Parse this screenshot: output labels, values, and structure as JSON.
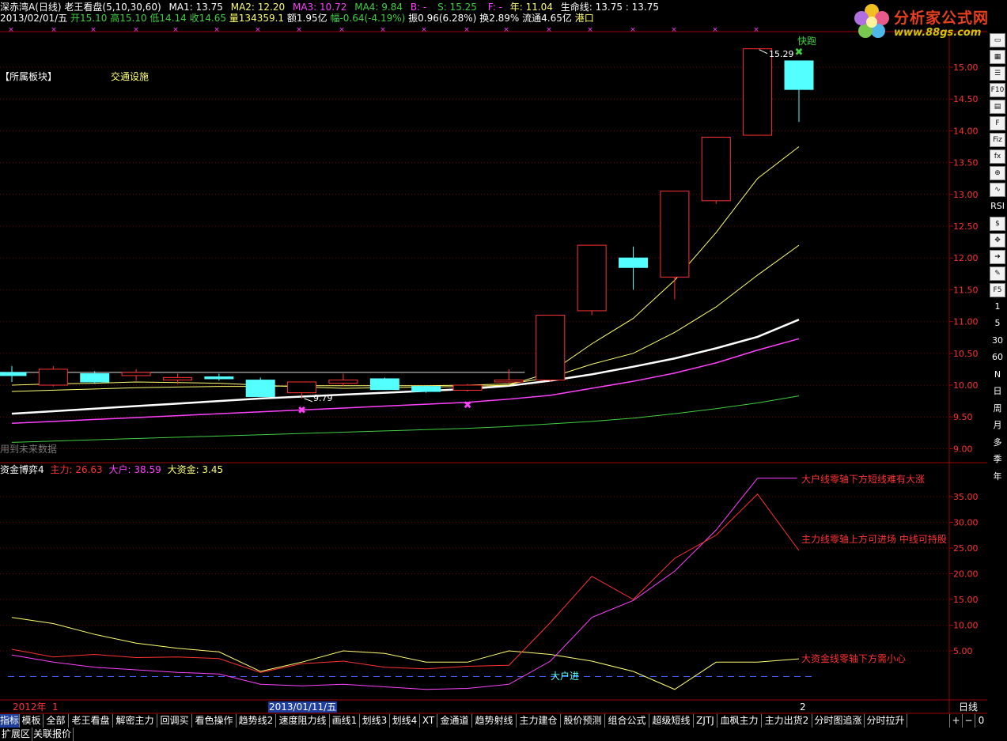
{
  "header": {
    "title_line": "深赤湾A(日线) 老王看盘(5,10,30,60)",
    "ma1": "MA1: 13.75",
    "ma2": "MA2: 12.20",
    "ma3": "MA3: 10.72",
    "ma4": "MA4: 9.84",
    "b": "B: -",
    "s": "S: 15.25",
    "f": "F: -",
    "nian": "年: 11.04",
    "shengming": "生命线: 13.75 : 13.75",
    "date": "2013/02/01/五",
    "open": "开15.10",
    "high": "高15.10",
    "low": "低14.14",
    "close": "收14.65",
    "vol": "量134359.1",
    "amount": "额1.95亿",
    "change": "幅-0.64(-4.19%)",
    "amplitude": "振0.96(6.28%)",
    "turnover": "换2.89%",
    "float": "流通4.65亿",
    "industry": "港口"
  },
  "logo": {
    "title": "分析家公式网",
    "url": "www.88gs.com"
  },
  "main_panel": {
    "sector_label": "【所属板块】",
    "sector_value": "交通设施",
    "signal_top": "快跑",
    "high_label": "15.29",
    "low_label": "9.79",
    "future_note": "用到未来数据",
    "y_ticks": [
      "15.00",
      "14.50",
      "14.00",
      "13.50",
      "13.00",
      "12.50",
      "12.00",
      "11.50",
      "11.00",
      "10.50",
      "10.00",
      "9.50",
      "9.00"
    ]
  },
  "indicator_panel": {
    "name": "资金博弈4",
    "zhuli": "主力: 26.63",
    "dahu": "大户: 38.59",
    "dazijin": "大资金: 3.45",
    "note_dahu": "大户线零轴下方短线难有大涨",
    "note_zhuli": "主力线零轴上方可进场 中线可持股",
    "note_dazijin": "大资金线零轴下方需小心",
    "dahu_in": "大户进",
    "y_ticks": [
      "35.00",
      "30.00",
      "25.00",
      "20.00",
      "15.00",
      "10.00",
      "5.00"
    ]
  },
  "time_axis": {
    "year": "2012年",
    "m1": "1",
    "cursor_date": "2013/01/11/五",
    "m2": "2",
    "period": "日线"
  },
  "toolbar": {
    "icons": [
      "window-icon",
      "grid-icon",
      "list-icon",
      "f10-icon",
      "table-icon",
      "f-icon",
      "fiz-icon",
      "formula-icon",
      "zoom-icon",
      "wave-icon"
    ],
    "rsi": "RSI",
    "icons2": [
      "money-icon",
      "move-icon",
      "arrow-icon",
      "pen-icon"
    ],
    "f5": "F5",
    "periods": [
      "1",
      "5",
      "30",
      "60",
      "N",
      "日",
      "周",
      "月",
      "多",
      "季",
      "年"
    ]
  },
  "tabs": [
    "指标",
    "模板",
    "全部",
    "老王看盘",
    "解密主力",
    "回调买",
    "看色操作",
    "趋势线2",
    "速度阻力线",
    "画线1",
    "划线3",
    "划线4",
    "XT",
    "金通道",
    "趋势射线",
    "主力建仓",
    "股价预测",
    "组合公式",
    "超级短线",
    "ZJTJ",
    "血枫主力",
    "主力出货2",
    "分时图追涨",
    "分时拉升"
  ],
  "controls": {
    "plus": "+",
    "minus": "−",
    "zero": "0"
  },
  "bottom_tabs": [
    "扩展区",
    "关联报价"
  ],
  "colors": {
    "up": "#ff3232",
    "down": "#54ffff",
    "ma_yellow": "#ffff70",
    "white": "#ffffff",
    "magenta": "#ff40ff",
    "green": "#40d040",
    "grid": "#7a0000"
  },
  "chart_data": {
    "type": "candlestick",
    "candles": [
      {
        "o": 10.2,
        "h": 10.3,
        "l": 10.05,
        "c": 10.15
      },
      {
        "o": 10.0,
        "h": 10.3,
        "l": 9.98,
        "c": 10.25
      },
      {
        "o": 10.18,
        "h": 10.22,
        "l": 10.02,
        "c": 10.05
      },
      {
        "o": 10.15,
        "h": 10.25,
        "l": 10.07,
        "c": 10.2
      },
      {
        "o": 10.08,
        "h": 10.18,
        "l": 10.02,
        "c": 10.12
      },
      {
        "o": 10.13,
        "h": 10.18,
        "l": 10.07,
        "c": 10.1
      },
      {
        "o": 10.08,
        "h": 10.12,
        "l": 9.88,
        "c": 9.82
      },
      {
        "o": 9.88,
        "h": 10.05,
        "l": 9.79,
        "c": 10.05
      },
      {
        "o": 10.03,
        "h": 10.18,
        "l": 9.98,
        "c": 10.08
      },
      {
        "o": 10.1,
        "h": 10.12,
        "l": 9.95,
        "c": 9.93
      },
      {
        "o": 9.98,
        "h": 10.0,
        "l": 9.88,
        "c": 9.9
      },
      {
        "o": 9.92,
        "h": 10.02,
        "l": 9.9,
        "c": 10.0
      },
      {
        "o": 10.05,
        "h": 10.25,
        "l": 10.03,
        "c": 10.08
      },
      {
        "o": 10.08,
        "h": 11.1,
        "l": 10.05,
        "c": 11.1
      },
      {
        "o": 11.17,
        "h": 12.2,
        "l": 11.1,
        "c": 12.2
      },
      {
        "o": 12.0,
        "h": 12.18,
        "l": 11.5,
        "c": 11.85
      },
      {
        "o": 11.7,
        "h": 13.05,
        "l": 11.35,
        "c": 13.05
      },
      {
        "o": 12.9,
        "h": 13.9,
        "l": 12.85,
        "c": 13.9
      },
      {
        "o": 13.93,
        "h": 15.29,
        "l": 13.93,
        "c": 15.29
      },
      {
        "o": 15.1,
        "h": 15.1,
        "l": 14.14,
        "c": 14.65
      }
    ],
    "ma1": [
      10.0,
      10.02,
      10.03,
      10.05,
      10.04,
      10.03,
      10.0,
      9.97,
      9.95,
      9.96,
      9.97,
      9.98,
      10.0,
      10.2,
      10.65,
      11.05,
      11.65,
      12.4,
      13.25,
      13.75
    ],
    "ma2": [
      9.9,
      9.92,
      9.94,
      9.96,
      9.97,
      9.98,
      9.98,
      9.99,
      9.99,
      9.99,
      9.99,
      10.0,
      10.02,
      10.12,
      10.33,
      10.5,
      10.83,
      11.23,
      11.73,
      12.2
    ],
    "ma3": [
      9.55,
      9.59,
      9.63,
      9.67,
      9.71,
      9.75,
      9.79,
      9.82,
      9.85,
      9.88,
      9.91,
      9.94,
      9.99,
      10.07,
      10.17,
      10.29,
      10.42,
      10.58,
      10.76,
      10.72
    ],
    "ma4": [
      9.4,
      9.43,
      9.46,
      9.49,
      9.52,
      9.55,
      9.58,
      9.61,
      9.64,
      9.67,
      9.7,
      9.73,
      9.78,
      9.84,
      9.95,
      10.06,
      10.19,
      10.35,
      10.55,
      9.84
    ],
    "ma5": [
      9.1,
      9.12,
      9.14,
      9.16,
      9.18,
      9.2,
      9.22,
      9.24,
      9.26,
      9.28,
      9.3,
      9.32,
      9.35,
      9.39,
      9.43,
      9.48,
      9.55,
      9.63,
      9.72,
      9.83
    ],
    "zhuli": [
      5.3,
      3.8,
      4.3,
      3.7,
      3.8,
      3.5,
      0.8,
      2.5,
      3.0,
      1.8,
      1.5,
      2.0,
      2.2,
      10.5,
      19.5,
      15.0,
      23.0,
      27.5,
      35.5,
      26.63
    ],
    "dahu": [
      4.2,
      2.8,
      1.8,
      1.3,
      0.8,
      0.5,
      -1.5,
      -1.8,
      -1.5,
      -2.0,
      -2.5,
      -2.3,
      -1.5,
      3.0,
      11.5,
      14.8,
      20.5,
      28.5,
      38.59,
      38.59
    ],
    "dazijin": [
      11.5,
      10.3,
      8.2,
      6.5,
      5.5,
      4.8,
      1.0,
      2.8,
      5.0,
      4.5,
      2.8,
      2.8,
      5.0,
      4.3,
      3.0,
      1.0,
      -2.5,
      2.8,
      2.8,
      3.45
    ]
  }
}
